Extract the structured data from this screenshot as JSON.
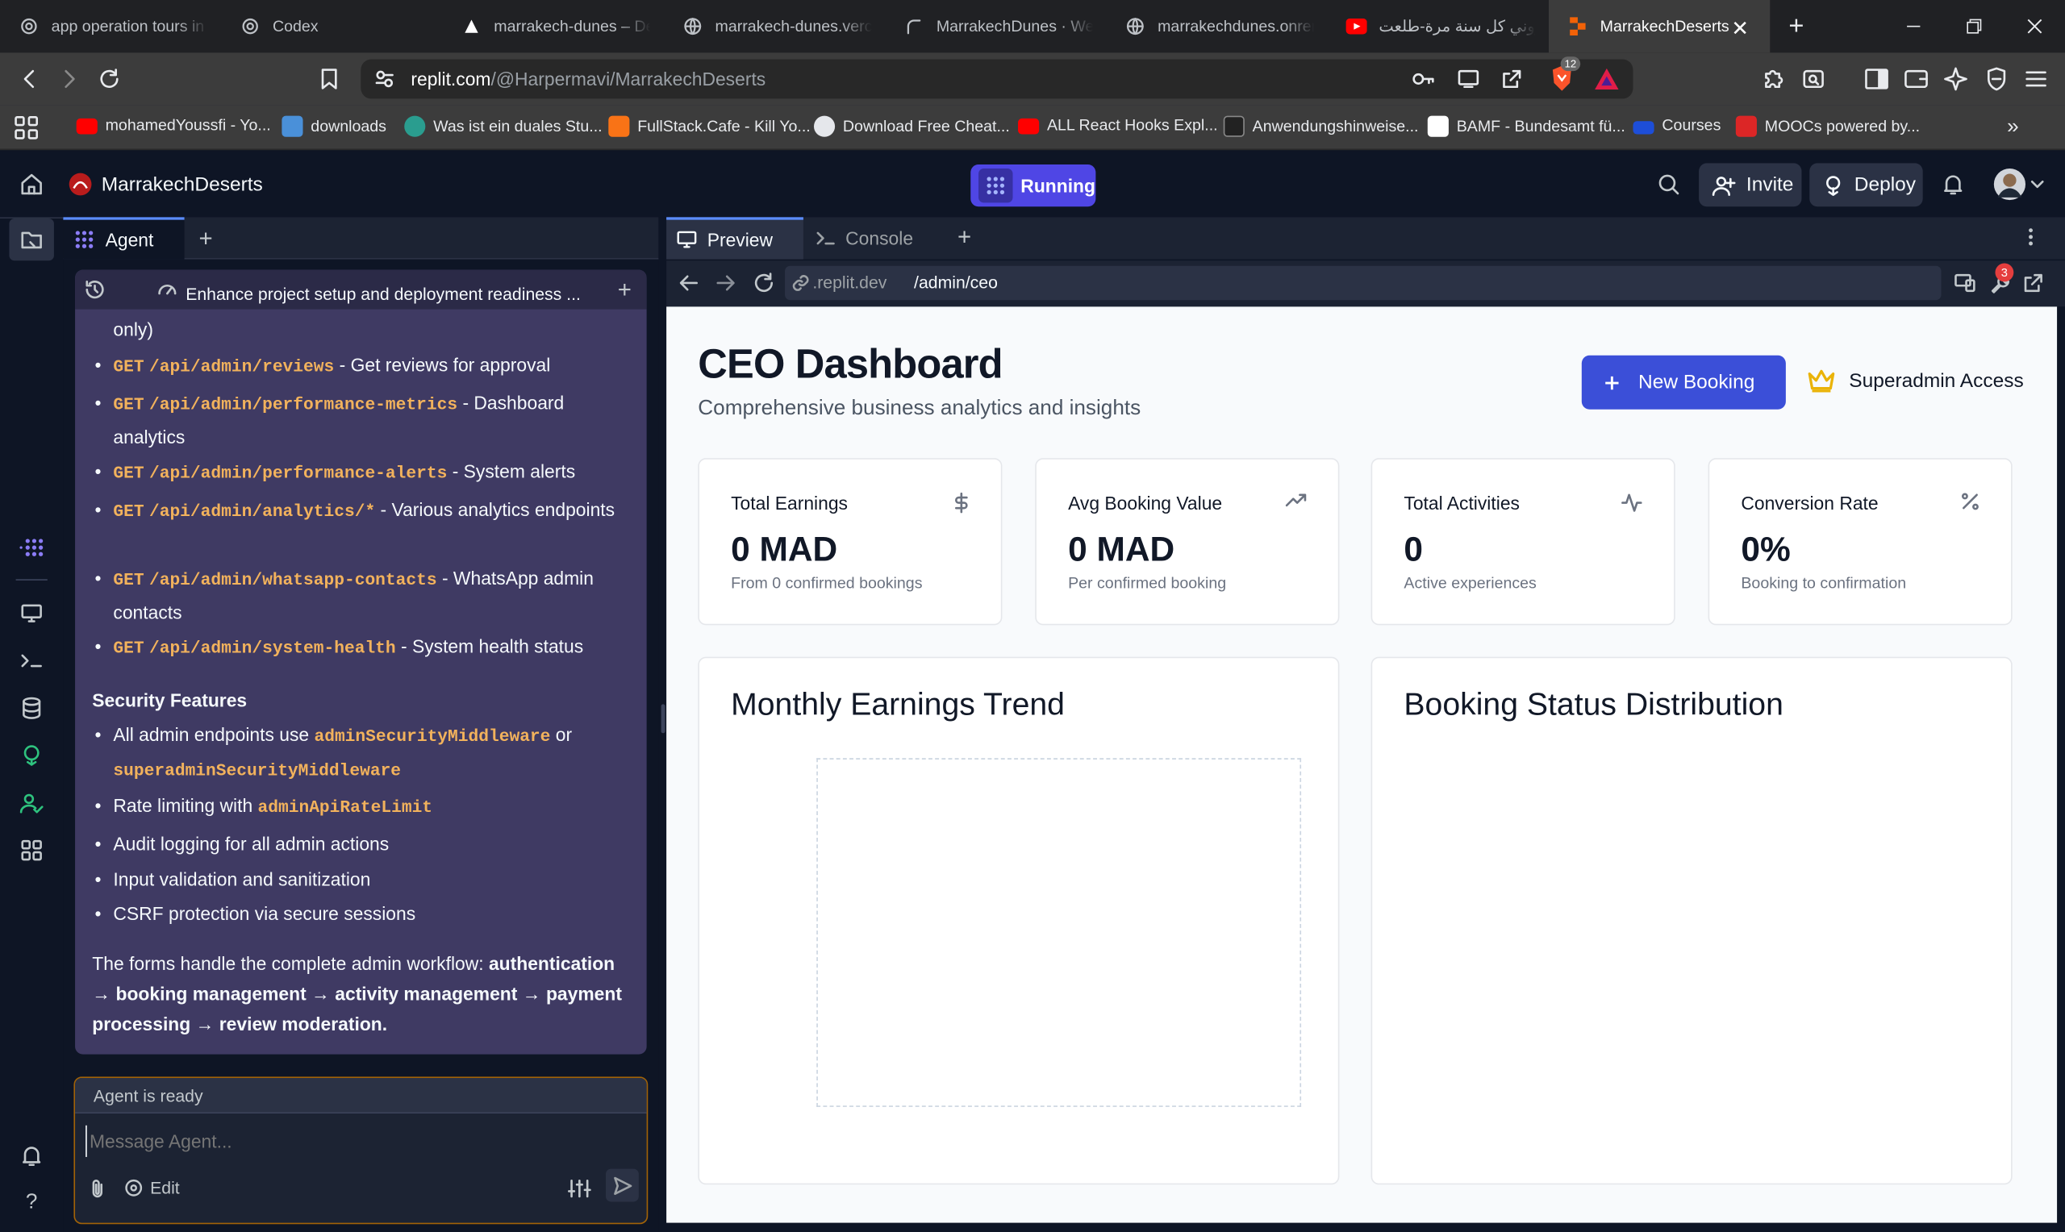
{
  "browser": {
    "tabs": [
      {
        "title": "app operation tours in m",
        "icon": "openai-icon",
        "active": false
      },
      {
        "title": "Codex",
        "icon": "openai-icon",
        "active": false
      },
      {
        "title": "marrakech-dunes – Depl",
        "icon": "vercel-icon",
        "active": false
      },
      {
        "title": "marrakech-dunes.vercel",
        "icon": "globe-icon",
        "active": false
      },
      {
        "title": "MarrakechDunes · Web",
        "icon": "render-icon",
        "active": false
      },
      {
        "title": "marrakechdunes.onrend",
        "icon": "globe-icon",
        "active": false
      },
      {
        "title": "زوروني كل سنة مرة-طلعت",
        "icon": "youtube-icon",
        "active": false
      },
      {
        "title": "MarrakechDeserts",
        "icon": "replit-icon",
        "active": true
      }
    ],
    "url_host": "replit.com",
    "url_path": "/@Harpermavi/MarrakechDeserts",
    "brave_badge": "12",
    "bookmarks": [
      {
        "label": "mohamedYoussfi - Yo...",
        "color": "#ff0000"
      },
      {
        "label": "downloads",
        "color": "#4a90d9"
      },
      {
        "label": "Was ist ein duales Stu...",
        "color": "#2a9d8f"
      },
      {
        "label": "FullStack.Cafe - Kill Yo...",
        "color": "#f97316"
      },
      {
        "label": "Download Free Cheat...",
        "color": "#e5e7eb"
      },
      {
        "label": "ALL React Hooks Expl...",
        "color": "#ff0000"
      },
      {
        "label": "Anwendungshinweise...",
        "color": "#222222"
      },
      {
        "label": "BAMF - Bundesamt fü...",
        "color": "#ffffff"
      },
      {
        "label": "Courses",
        "color": "#1d4ed8"
      },
      {
        "label": "MOOCs powered by...",
        "color": "#dc2626"
      }
    ]
  },
  "replit": {
    "project": "MarrakechDeserts",
    "run_label": "Running",
    "invite_label": "Invite",
    "deploy_label": "Deploy"
  },
  "agent": {
    "tab_label": "Agent",
    "thread_title": "Enhance project setup and deployment readiness ...",
    "fragment": "only)",
    "endpoints": [
      {
        "method": "GET",
        "path": "/api/admin/reviews",
        "desc": " - Get reviews for approval"
      },
      {
        "method": "GET",
        "path": "/api/admin/performance-metrics",
        "desc": " - Dashboard analytics"
      },
      {
        "method": "GET",
        "path": "/api/admin/performance-alerts",
        "desc": " - System alerts"
      },
      {
        "method": "GET",
        "path": "/api/admin/analytics/*",
        "desc": " - Various analytics endpoints"
      },
      {
        "method": "GET",
        "path": "/api/admin/whatsapp-contacts",
        "desc": " - WhatsApp admin contacts"
      },
      {
        "method": "GET",
        "path": "/api/admin/system-health",
        "desc": " - System health status"
      }
    ],
    "security_heading": "Security Features",
    "sec1_a": "All admin endpoints use ",
    "sec1_code1": "adminSecurityMiddleware",
    "sec1_or": " or",
    "sec1_code2": "superadminSecurityMiddleware",
    "sec2_a": "Rate limiting with ",
    "sec2_code": "adminApiRateLimit",
    "sec3": "Audit logging for all admin actions",
    "sec4": "Input validation and sanitization",
    "sec5": "CSRF protection via secure sessions",
    "summary_a": "The forms handle the complete admin workflow: ",
    "summary_b": "authentication → booking management → activity management → payment processing → review moderation.",
    "status": "Agent is ready",
    "placeholder": "Message Agent...",
    "edit_label": "Edit"
  },
  "preview": {
    "tab_preview": "Preview",
    "tab_console": "Console",
    "url_host": ".replit.dev",
    "url_path": "/admin/ceo",
    "badge": "3"
  },
  "dashboard": {
    "title": "CEO Dashboard",
    "subtitle": "Comprehensive business analytics and insights",
    "new_booking": "New Booking",
    "superadmin": "Superadmin Access",
    "cards": [
      {
        "label": "Total Earnings",
        "value": "0 MAD",
        "sub": "From 0 confirmed bookings",
        "icon": "dollar-icon"
      },
      {
        "label": "Avg Booking Value",
        "value": "0 MAD",
        "sub": "Per confirmed booking",
        "icon": "trending-up-icon"
      },
      {
        "label": "Total Activities",
        "value": "0",
        "sub": "Active experiences",
        "icon": "activity-icon"
      },
      {
        "label": "Conversion Rate",
        "value": "0%",
        "sub": "Booking to confirmation",
        "icon": "percent-icon"
      }
    ],
    "chart1_title": "Monthly Earnings Trend",
    "chart2_title": "Booking Status Distribution",
    "accent": "#3b4fd8",
    "crown_color": "#eab308"
  }
}
